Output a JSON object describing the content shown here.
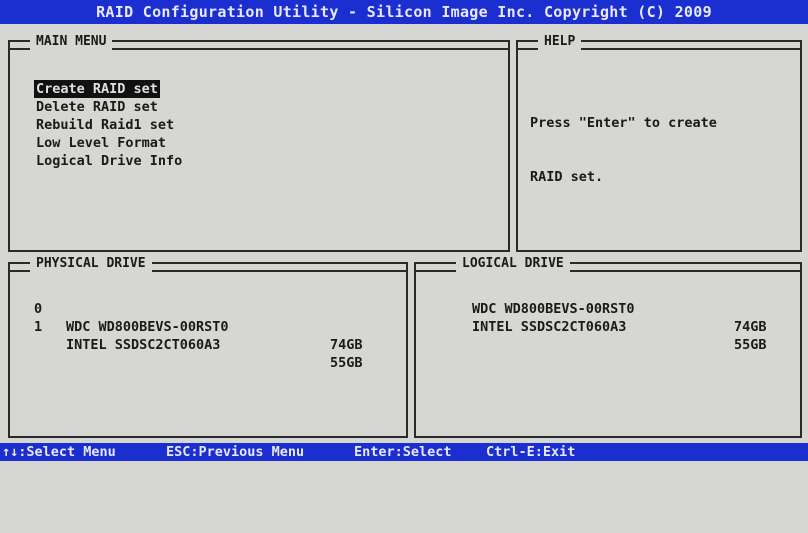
{
  "title": "RAID Configuration Utility - Silicon Image Inc. Copyright (C) 2009",
  "main_menu": {
    "title": "MAIN MENU",
    "items": [
      "Create RAID set",
      "Delete RAID set",
      "Rebuild Raid1 set",
      "Low Level Format",
      "Logical Drive Info"
    ]
  },
  "help": {
    "title": "HELP",
    "lines": [
      "Press \"Enter\" to create",
      "RAID set."
    ]
  },
  "physical_drive": {
    "title": "PHYSICAL DRIVE",
    "rows": [
      {
        "index": "0",
        "name": "WDC WD800BEVS-00RST0",
        "size": "74GB"
      },
      {
        "index": "1",
        "name": "INTEL SSDSC2CT060A3",
        "size": "55GB"
      }
    ]
  },
  "logical_drive": {
    "title": "LOGICAL DRIVE",
    "rows": [
      {
        "name": "WDC WD800BEVS-00RST0",
        "size": "74GB"
      },
      {
        "name": "INTEL SSDSC2CT060A3",
        "size": "55GB"
      }
    ]
  },
  "statusbar": {
    "select_menu": "↑↓:Select Menu",
    "previous_menu": "ESC:Previous Menu",
    "enter_select": "Enter:Select",
    "exit": "Ctrl-E:Exit"
  },
  "colors": {
    "bar": "#1b2fd0",
    "background": "#d6d6d2",
    "text": "#1a1a1a"
  }
}
